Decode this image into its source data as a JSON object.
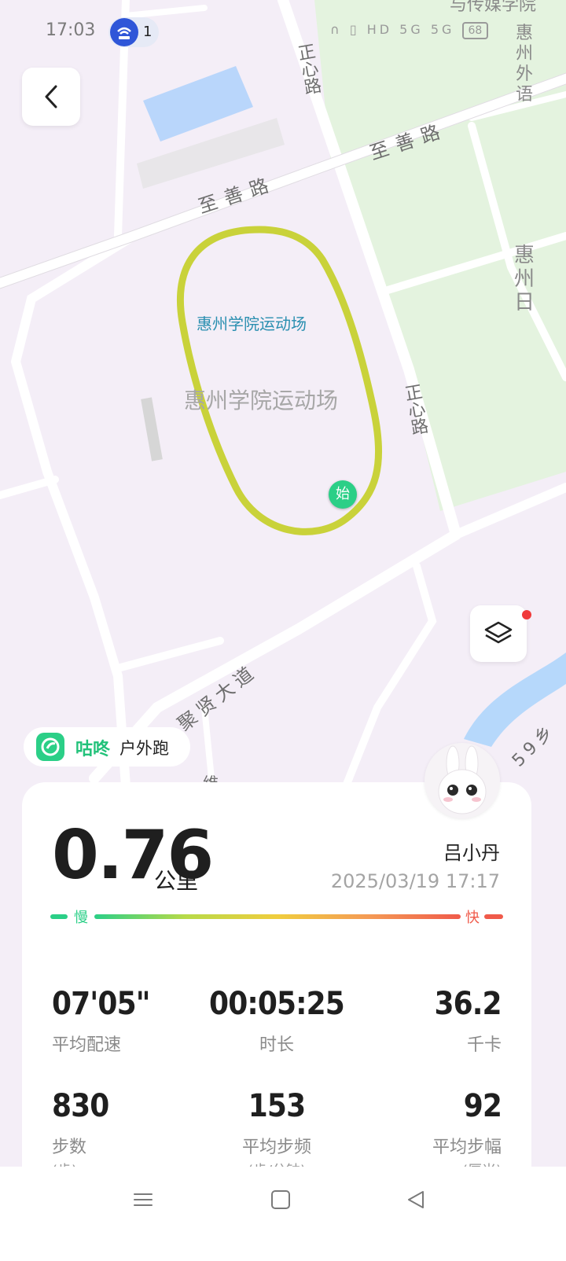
{
  "status_bar": {
    "time": "17:03",
    "hotspot_count": "1",
    "network": "HD 5G 5G",
    "battery": "68"
  },
  "map": {
    "road_labels": [
      "正心路",
      "至善路",
      "至善路",
      "正心路",
      "聚贤大道",
      "59乡",
      "维"
    ],
    "place_labels": {
      "stadium_marker": "惠州学院运动场",
      "stadium_area": "惠州学院运动场",
      "top_right": "与传媒学院",
      "right_1": "惠州外语",
      "right_2": "惠州日"
    },
    "start_marker": "始",
    "route_color": "#c9d23a",
    "road_color": "#ffffff",
    "land_color": "#f4eef7",
    "park_color": "#e4f3df",
    "water_color": "#b6d8fb"
  },
  "brand": {
    "name": "咕咚",
    "mode": "户外跑",
    "color": "#22c27a"
  },
  "summary": {
    "distance": "0.76",
    "distance_unit": "公里",
    "user_name": "吕小丹",
    "datetime": "2025/03/19 17:17",
    "pace_slow": "慢",
    "pace_fast": "快",
    "stats": [
      {
        "value": "07'05\"",
        "label": "平均配速",
        "unit": ""
      },
      {
        "value": "00:05:25",
        "label": "时长",
        "unit": ""
      },
      {
        "value": "36.2",
        "label": "千卡",
        "unit": ""
      },
      {
        "value": "830",
        "label": "步数",
        "unit": "(步)"
      },
      {
        "value": "153",
        "label": "平均步频",
        "unit": "(步/分钟)"
      },
      {
        "value": "92",
        "label": "平均步幅",
        "unit": "(厘米)"
      }
    ]
  }
}
